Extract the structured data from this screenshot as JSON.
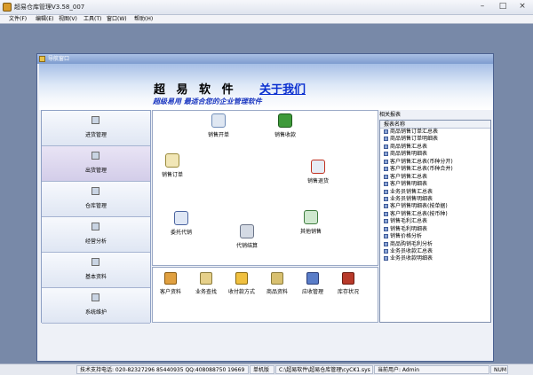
{
  "app": {
    "title": "超易仓库管理V3.58_007",
    "min": "–",
    "max": "□",
    "close": "×"
  },
  "menu": [
    "文件(F)",
    "编辑(E)",
    "视图(V)",
    "工具(T)",
    "窗口(W)",
    "帮助(H)"
  ],
  "nav_window": {
    "title": "导航窗口"
  },
  "banner": {
    "headline": "超 易 软 件",
    "link": "关于我们",
    "slogan": "超级易用 最适合您的企业管理软件"
  },
  "sidebar": [
    {
      "label": "进货管理"
    },
    {
      "label": "出货管理",
      "selected": true
    },
    {
      "label": "仓库管理"
    },
    {
      "label": "经营分析"
    },
    {
      "label": "基本资料"
    },
    {
      "label": "系统维护"
    }
  ],
  "center_items": [
    "销售开单",
    "销售收款",
    "销售订单",
    "销售退货",
    "委托代销",
    "代销结算",
    "其他销售"
  ],
  "bottom_items": [
    "客户资料",
    "业务查找",
    "收付款方式",
    "商品资料",
    "应收管理",
    "库存状况"
  ],
  "reports": {
    "title": "相关报表",
    "header": "报表名称",
    "items": [
      "商品销售订单汇总表",
      "商品销售订单明细表",
      "商品销售汇总表",
      "商品销售明细表",
      "客户销售汇总表(币种分开)",
      "客户销售汇总表(币种合并)",
      "客户销售汇总表",
      "客户销售明细表",
      "业务员销售汇总表",
      "业务员销售明细表",
      "客户销售明细表(按单据)",
      "客户销售汇总表(按币种)",
      "销售毛利汇总表",
      "销售毛利明细表",
      "销售价格分析",
      "商品购销毛利分析",
      "业务员收款汇总表",
      "业务员收款明细表"
    ]
  },
  "status": {
    "phone": "技术支持电话: 020-82327296 85440935 QQ:408088750 19669",
    "mode": "单机版",
    "path": "C:\\超易软件\\超易仓库管理\\cyCK1.sys",
    "user": "当前用户: Admin",
    "num": "NUM"
  }
}
